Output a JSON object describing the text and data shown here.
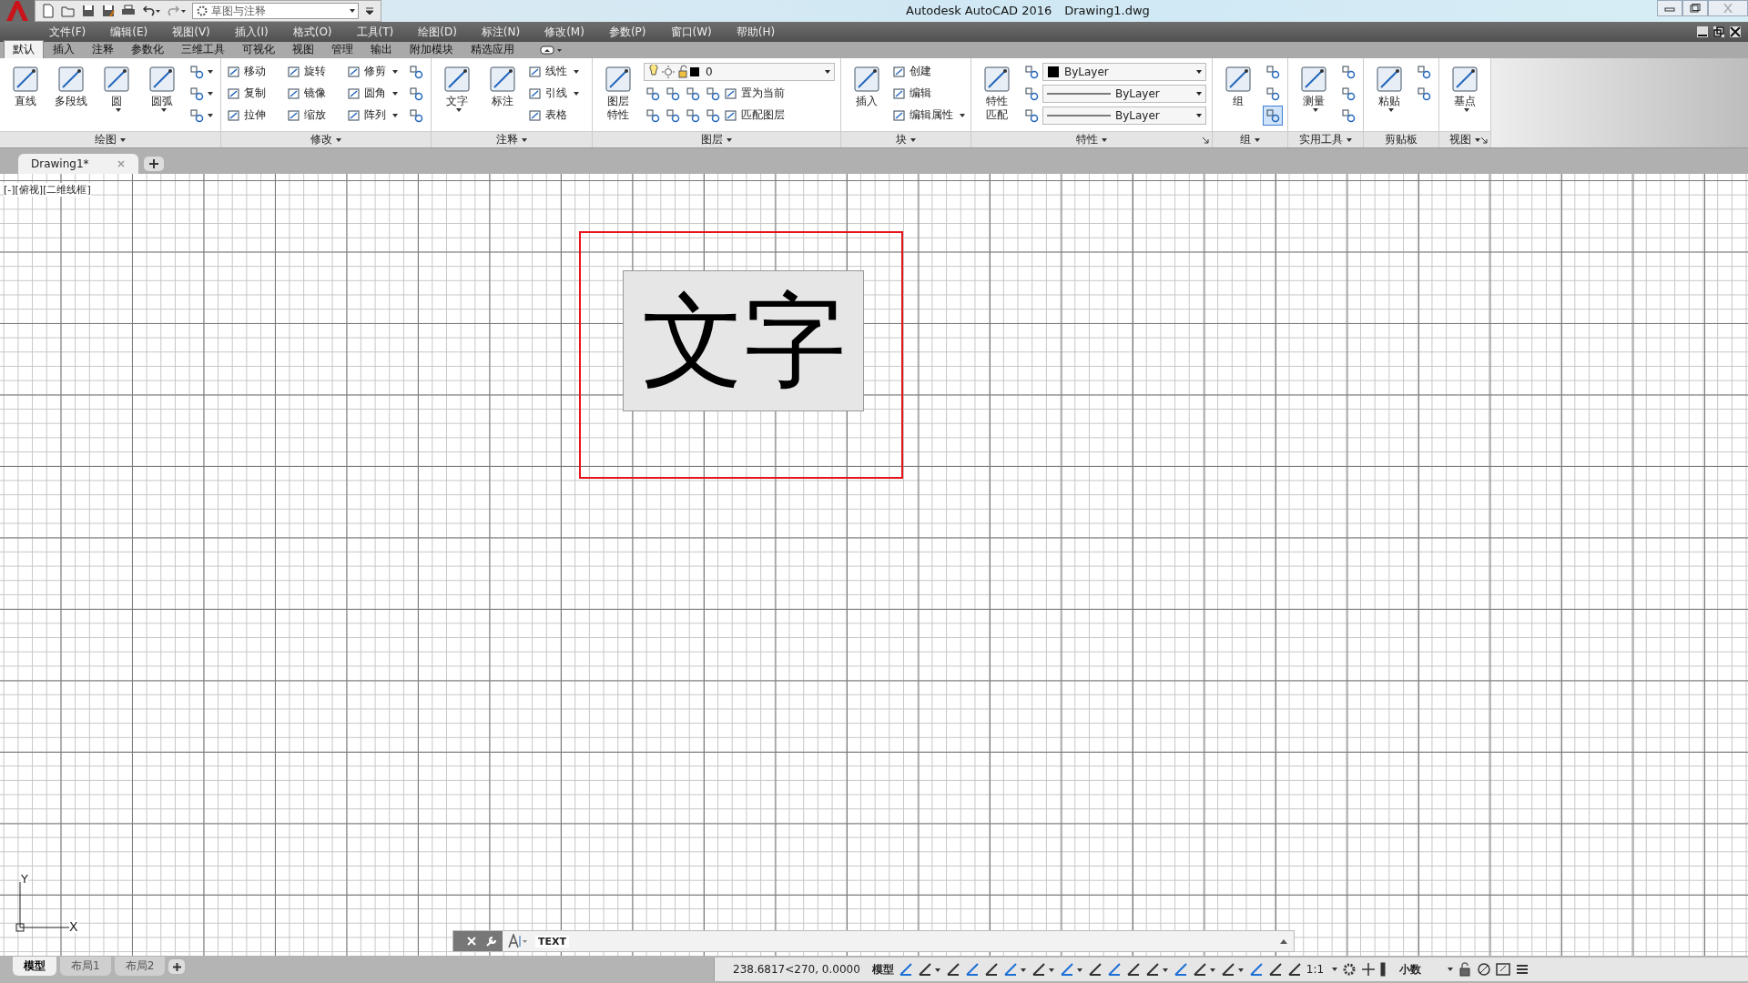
{
  "window": {
    "title": "Autodesk AutoCAD 2016",
    "document": "Drawing1.dwg"
  },
  "quick_access": {
    "workspace": "草图与注释"
  },
  "menu_bar": [
    "文件(F)",
    "编辑(E)",
    "视图(V)",
    "插入(I)",
    "格式(O)",
    "工具(T)",
    "绘图(D)",
    "标注(N)",
    "修改(M)",
    "参数(P)",
    "窗口(W)",
    "帮助(H)"
  ],
  "ribbon_tabs": [
    {
      "label": "默认",
      "selected": true
    },
    {
      "label": "插入",
      "selected": false
    },
    {
      "label": "注释",
      "selected": false
    },
    {
      "label": "参数化",
      "selected": false
    },
    {
      "label": "三维工具",
      "selected": false
    },
    {
      "label": "可视化",
      "selected": false
    },
    {
      "label": "视图",
      "selected": false
    },
    {
      "label": "管理",
      "selected": false
    },
    {
      "label": "输出",
      "selected": false
    },
    {
      "label": "附加模块",
      "selected": false
    },
    {
      "label": "精选应用",
      "selected": false
    }
  ],
  "ribbon_panels": [
    {
      "title": "绘图",
      "menu": true,
      "launcher": false,
      "large": [
        {
          "label": "直线",
          "dropdown": false
        },
        {
          "label": "多段线",
          "dropdown": false
        },
        {
          "label": "圆",
          "dropdown": true
        },
        {
          "label": "圆弧",
          "dropdown": true
        }
      ],
      "rows": [
        [
          {
            "kind": "icon",
            "dropdown": true
          }
        ],
        [
          {
            "kind": "icon",
            "dropdown": true
          }
        ],
        [
          {
            "kind": "icon",
            "dropdown": true
          }
        ]
      ]
    },
    {
      "title": "修改",
      "menu": true,
      "launcher": false,
      "rows": [
        [
          {
            "kind": "small",
            "label": "移动",
            "dropdown": false
          },
          {
            "kind": "small",
            "label": "旋转",
            "dropdown": false
          },
          {
            "kind": "small",
            "label": "修剪",
            "dropdown": true
          },
          {
            "kind": "icon",
            "dropdown": false
          }
        ],
        [
          {
            "kind": "small",
            "label": "复制",
            "dropdown": false
          },
          {
            "kind": "small",
            "label": "镜像",
            "dropdown": false
          },
          {
            "kind": "small",
            "label": "圆角",
            "dropdown": true
          },
          {
            "kind": "icon",
            "dropdown": false
          }
        ],
        [
          {
            "kind": "small",
            "label": "拉伸",
            "dropdown": false
          },
          {
            "kind": "small",
            "label": "缩放",
            "dropdown": false
          },
          {
            "kind": "small",
            "label": "阵列",
            "dropdown": true
          },
          {
            "kind": "icon",
            "dropdown": false
          }
        ]
      ]
    },
    {
      "title": "注释",
      "menu": true,
      "launcher": false,
      "large": [
        {
          "label": "文字",
          "dropdown": true
        },
        {
          "label": "标注",
          "dropdown": false
        }
      ],
      "rows": [
        [
          {
            "kind": "small",
            "label": "线性",
            "dropdown": true
          }
        ],
        [
          {
            "kind": "small",
            "label": "引线",
            "dropdown": true
          }
        ],
        [
          {
            "kind": "small",
            "label": "表格",
            "dropdown": false
          }
        ]
      ]
    },
    {
      "title": "图层",
      "menu": true,
      "launcher": false,
      "large": [
        {
          "label": "图层特性",
          "dropdown": false
        }
      ],
      "rows": [
        [
          {
            "kind": "layer-combo",
            "label": "0"
          }
        ],
        [
          {
            "kind": "icon",
            "dropdown": false
          },
          {
            "kind": "icon",
            "dropdown": false
          },
          {
            "kind": "icon",
            "dropdown": false
          },
          {
            "kind": "icon",
            "dropdown": false
          },
          {
            "kind": "small",
            "label": "置为当前",
            "dropdown": false
          }
        ],
        [
          {
            "kind": "icon",
            "dropdown": false
          },
          {
            "kind": "icon",
            "dropdown": false
          },
          {
            "kind": "icon",
            "dropdown": false
          },
          {
            "kind": "icon",
            "dropdown": false
          },
          {
            "kind": "small",
            "label": "匹配图层",
            "dropdown": false
          }
        ]
      ]
    },
    {
      "title": "块",
      "menu": true,
      "launcher": false,
      "large": [
        {
          "label": "插入",
          "dropdown": false
        }
      ],
      "rows": [
        [
          {
            "kind": "small",
            "label": "创建",
            "dropdown": false
          }
        ],
        [
          {
            "kind": "small",
            "label": "编辑",
            "dropdown": false
          }
        ],
        [
          {
            "kind": "small",
            "label": "编辑属性",
            "dropdown": true
          }
        ]
      ]
    },
    {
      "title": "特性",
      "menu": true,
      "launcher": true,
      "large": [
        {
          "label": "特性匹配",
          "dropdown": false
        }
      ],
      "rows": [
        [
          {
            "kind": "icon",
            "dropdown": false
          },
          {
            "kind": "color-combo",
            "label": "ByLayer"
          }
        ],
        [
          {
            "kind": "icon",
            "dropdown": false
          },
          {
            "kind": "line-combo",
            "label": "ByLayer"
          }
        ],
        [
          {
            "kind": "icon",
            "dropdown": false
          },
          {
            "kind": "line-combo",
            "label": "ByLayer"
          }
        ]
      ]
    },
    {
      "title": "组",
      "menu": true,
      "launcher": false,
      "large": [
        {
          "label": "组",
          "dropdown": false
        }
      ],
      "rows": [
        [
          {
            "kind": "icon",
            "dropdown": false,
            "on": false
          }
        ],
        [
          {
            "kind": "icon",
            "dropdown": false,
            "on": false
          }
        ],
        [
          {
            "kind": "icon",
            "dropdown": false,
            "on": true
          }
        ]
      ]
    },
    {
      "title": "实用工具",
      "menu": true,
      "launcher": false,
      "large": [
        {
          "label": "测量",
          "dropdown": true
        }
      ],
      "rows": [
        [
          {
            "kind": "icon",
            "dropdown": false
          }
        ],
        [
          {
            "kind": "icon",
            "dropdown": false
          }
        ],
        [
          {
            "kind": "icon",
            "dropdown": false
          }
        ]
      ]
    },
    {
      "title": "剪贴板",
      "menu": false,
      "launcher": false,
      "large": [
        {
          "label": "粘贴",
          "dropdown": true
        }
      ],
      "rows": [
        [
          {
            "kind": "icon",
            "dropdown": false
          }
        ],
        [
          {
            "kind": "icon",
            "dropdown": false
          }
        ]
      ]
    },
    {
      "title": "视图",
      "menu": true,
      "launcher": true,
      "large": [
        {
          "label": "基点",
          "dropdown": true
        }
      ]
    }
  ],
  "document_tabs": [
    {
      "label": "Drawing1*",
      "selected": true
    }
  ],
  "viewport_label": "[-][俯视][二维线框]",
  "drawing": {
    "text": "文字",
    "selected": true
  },
  "ucs": {
    "x_label": "X",
    "y_label": "Y"
  },
  "command_line": {
    "command": "TEXT"
  },
  "layout_tabs": [
    {
      "label": "模型",
      "selected": true
    },
    {
      "label": "布局1",
      "selected": false
    },
    {
      "label": "布局2",
      "selected": false
    }
  ],
  "status_bar": {
    "coordinates": "238.6817<270, 0.0000",
    "space": "模型",
    "scale": "1:1",
    "units": "小数",
    "toggles": [
      {
        "on": true,
        "dropdown": false
      },
      {
        "on": false,
        "dropdown": true
      },
      {
        "on": false,
        "dropdown": false
      },
      {
        "on": true,
        "dropdown": false
      },
      {
        "on": false,
        "dropdown": false
      },
      {
        "on": true,
        "dropdown": true
      },
      {
        "on": false,
        "dropdown": true
      },
      {
        "on": true,
        "dropdown": true
      },
      {
        "on": false,
        "dropdown": false
      },
      {
        "on": true,
        "dropdown": false
      },
      {
        "on": false,
        "dropdown": false
      },
      {
        "on": false,
        "dropdown": true
      },
      {
        "on": true,
        "dropdown": false
      },
      {
        "on": false,
        "dropdown": true
      },
      {
        "on": false,
        "dropdown": true
      },
      {
        "on": true,
        "dropdown": false
      },
      {
        "on": false,
        "dropdown": false
      },
      {
        "on": false,
        "dropdown": false
      }
    ]
  }
}
